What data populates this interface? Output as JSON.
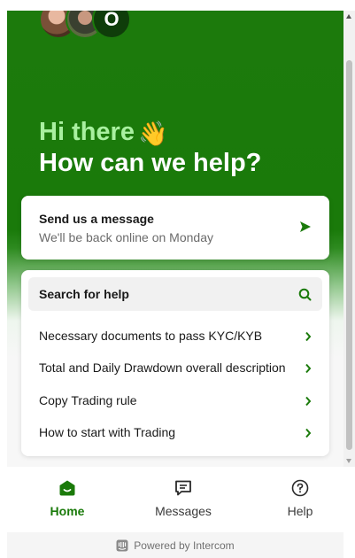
{
  "header": {
    "avatar_initial": "O",
    "greeting_line1": "Hi there",
    "greeting_emoji": "👋",
    "greeting_line2": "How can we help?"
  },
  "message_card": {
    "title": "Send us a message",
    "subtitle": "We'll be back online on Monday",
    "icon": "send-icon"
  },
  "help_card": {
    "search_label": "Search for help",
    "search_icon": "search-icon",
    "items": [
      {
        "label": "Necessary documents to pass KYC/KYB"
      },
      {
        "label": "Total and Daily Drawdown overall description"
      },
      {
        "label": "Copy Trading rule"
      },
      {
        "label": "How to start with Trading"
      }
    ]
  },
  "nav": {
    "items": [
      {
        "label": "Home",
        "icon": "home-icon",
        "active": true
      },
      {
        "label": "Messages",
        "icon": "messages-icon",
        "active": false
      },
      {
        "label": "Help",
        "icon": "help-icon",
        "active": false
      }
    ]
  },
  "footer": {
    "powered_by": "Powered by Intercom",
    "icon": "intercom-icon"
  },
  "colors": {
    "brand_green": "#1a7a0a",
    "accent_light_green": "#a9f0a0"
  }
}
